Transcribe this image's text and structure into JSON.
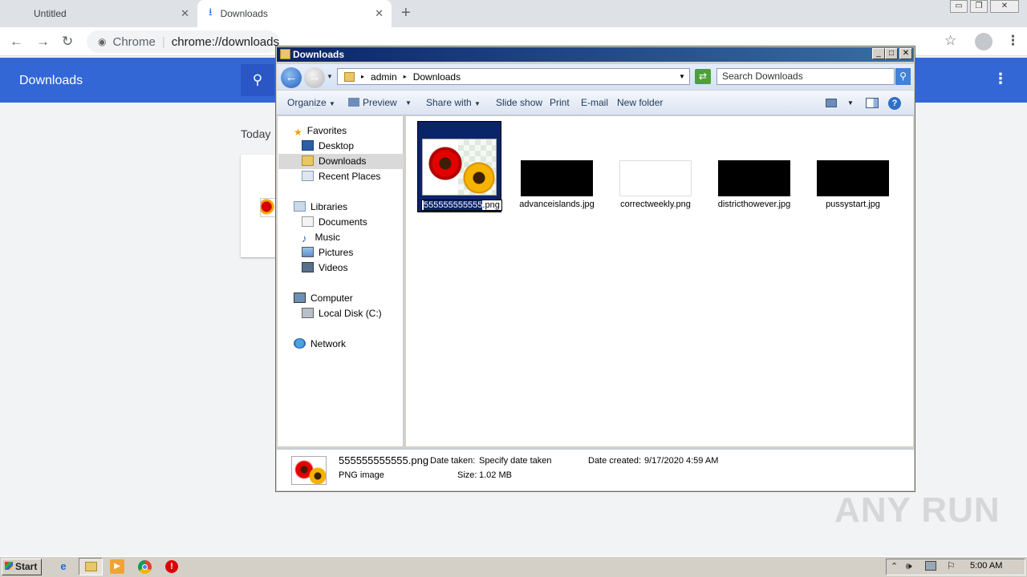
{
  "browser": {
    "tabs": [
      {
        "label": "Untitled"
      },
      {
        "label": "Downloads"
      }
    ],
    "omnibox": {
      "site": "Chrome",
      "url": "chrome://downloads"
    },
    "page": {
      "title": "Downloads",
      "section": "Today"
    }
  },
  "explorer": {
    "title": "Downloads",
    "breadcrumb": [
      "admin",
      "Downloads"
    ],
    "search_placeholder": "Search Downloads",
    "commands": [
      "Organize",
      "Preview",
      "Share with",
      "Slide show",
      "Print",
      "E-mail",
      "New folder"
    ],
    "nav": {
      "favorites": "Favorites",
      "desktop": "Desktop",
      "downloads": "Downloads",
      "recent": "Recent Places",
      "libraries": "Libraries",
      "documents": "Documents",
      "music": "Music",
      "pictures": "Pictures",
      "videos": "Videos",
      "computer": "Computer",
      "local_disk": "Local Disk (C:)",
      "network": "Network"
    },
    "files": {
      "selected_highlight": "555555555555",
      "selected_ext": ".png",
      "f2": "advanceislands.jpg",
      "f3": "correctweekly.png",
      "f4": "districthowever.jpg",
      "f5": "pussystart.jpg"
    },
    "details": {
      "name": "555555555555.png",
      "type": "PNG image",
      "date_taken_label": "Date taken:",
      "date_taken_value": "Specify date taken",
      "size_label": "Size:",
      "size_value": "1.02 MB",
      "created_label": "Date created:",
      "created_value": "9/17/2020 4:59 AM"
    }
  },
  "taskbar": {
    "start": "Start",
    "clock": "5:00 AM"
  },
  "watermark": "ANY RUN",
  "colors": {
    "chrome_blue": "#3367d6",
    "titlebar": "#0a246a",
    "selection": "#0a246a"
  }
}
